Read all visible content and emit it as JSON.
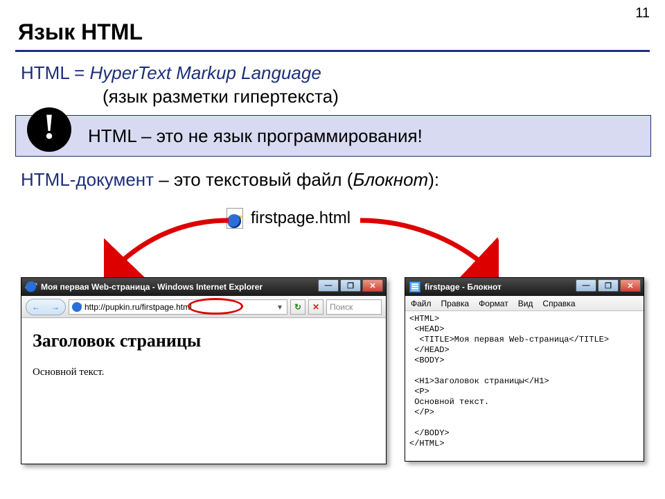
{
  "page_number": "11",
  "title": "Язык HTML",
  "definition": {
    "prefix": "HTML = ",
    "full_en": "HyperText Markup Language",
    "ru": "(язык разметки гипертекста)"
  },
  "callout": {
    "bang": "!",
    "text": "HTML – это не язык программирования!"
  },
  "doc_line": {
    "blue": "HTML-документ",
    "dash": " – это текстовый файл (",
    "ital": "Блокнот",
    "close": "):"
  },
  "file_label": "firstpage.html",
  "ie": {
    "title": "Моя первая Web-страница - Windows Internet Explorer",
    "url": "http://pupkin.ru/firstpage.html",
    "search_placeholder": "Поиск",
    "h1": "Заголовок страницы",
    "p": "Основной текст."
  },
  "notepad": {
    "title": "firstpage - Блокнот",
    "menu": [
      "Файл",
      "Правка",
      "Формат",
      "Вид",
      "Справка"
    ],
    "code": "<HTML>\n <HEAD>\n  <TITLE>Моя первая Web-страница</TITLE>\n </HEAD>\n <BODY>\n\n <H1>Заголовок страницы</H1>\n <P>\n Основной текст.\n </P>\n\n </BODY>\n</HTML>"
  },
  "window_controls": {
    "min": "—",
    "max": "❐",
    "close": "✕"
  },
  "nav_arrows": {
    "back": "←",
    "fwd": "→"
  },
  "refresh_glyph": "↻",
  "stop_glyph": "✕",
  "dropdown_glyph": "▾"
}
